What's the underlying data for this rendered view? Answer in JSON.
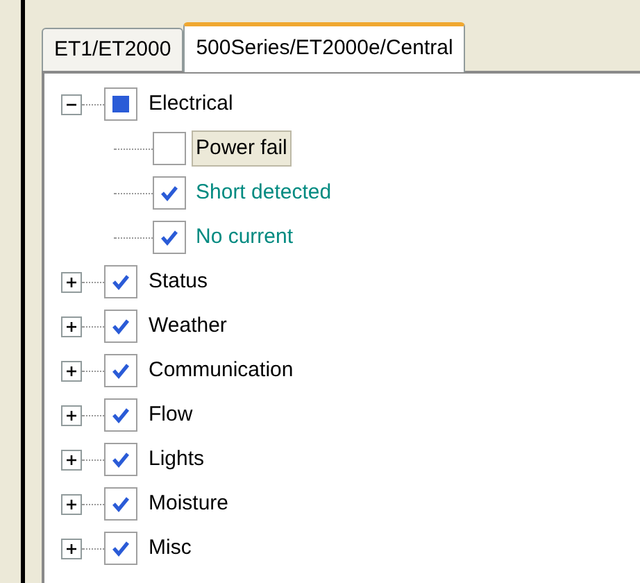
{
  "tabs": [
    {
      "label": "ET1/ET2000",
      "selected": false
    },
    {
      "label": "500Series/ET2000e/Central",
      "selected": true
    }
  ],
  "tree": [
    {
      "label": "Electrical",
      "expanded": true,
      "checked": true,
      "partial": true,
      "selected": false,
      "color": "#000000",
      "children": [
        {
          "label": "Power fail",
          "checked": false,
          "partial": false,
          "selected": true,
          "color": "#000000"
        },
        {
          "label": "Short detected",
          "checked": true,
          "partial": false,
          "selected": false,
          "color": "#008a80"
        },
        {
          "label": "No current",
          "checked": true,
          "partial": false,
          "selected": false,
          "color": "#008a80"
        }
      ]
    },
    {
      "label": "Status",
      "expanded": false,
      "checked": true,
      "partial": false,
      "selected": false,
      "color": "#000000"
    },
    {
      "label": "Weather",
      "expanded": false,
      "checked": true,
      "partial": false,
      "selected": false,
      "color": "#000000"
    },
    {
      "label": "Communication",
      "expanded": false,
      "checked": true,
      "partial": false,
      "selected": false,
      "color": "#000000"
    },
    {
      "label": "Flow",
      "expanded": false,
      "checked": true,
      "partial": false,
      "selected": false,
      "color": "#000000"
    },
    {
      "label": "Lights",
      "expanded": false,
      "checked": true,
      "partial": false,
      "selected": false,
      "color": "#000000"
    },
    {
      "label": "Moisture",
      "expanded": false,
      "checked": true,
      "partial": false,
      "selected": false,
      "color": "#000000"
    },
    {
      "label": "Misc",
      "expanded": false,
      "checked": true,
      "partial": false,
      "selected": false,
      "color": "#000000"
    }
  ]
}
